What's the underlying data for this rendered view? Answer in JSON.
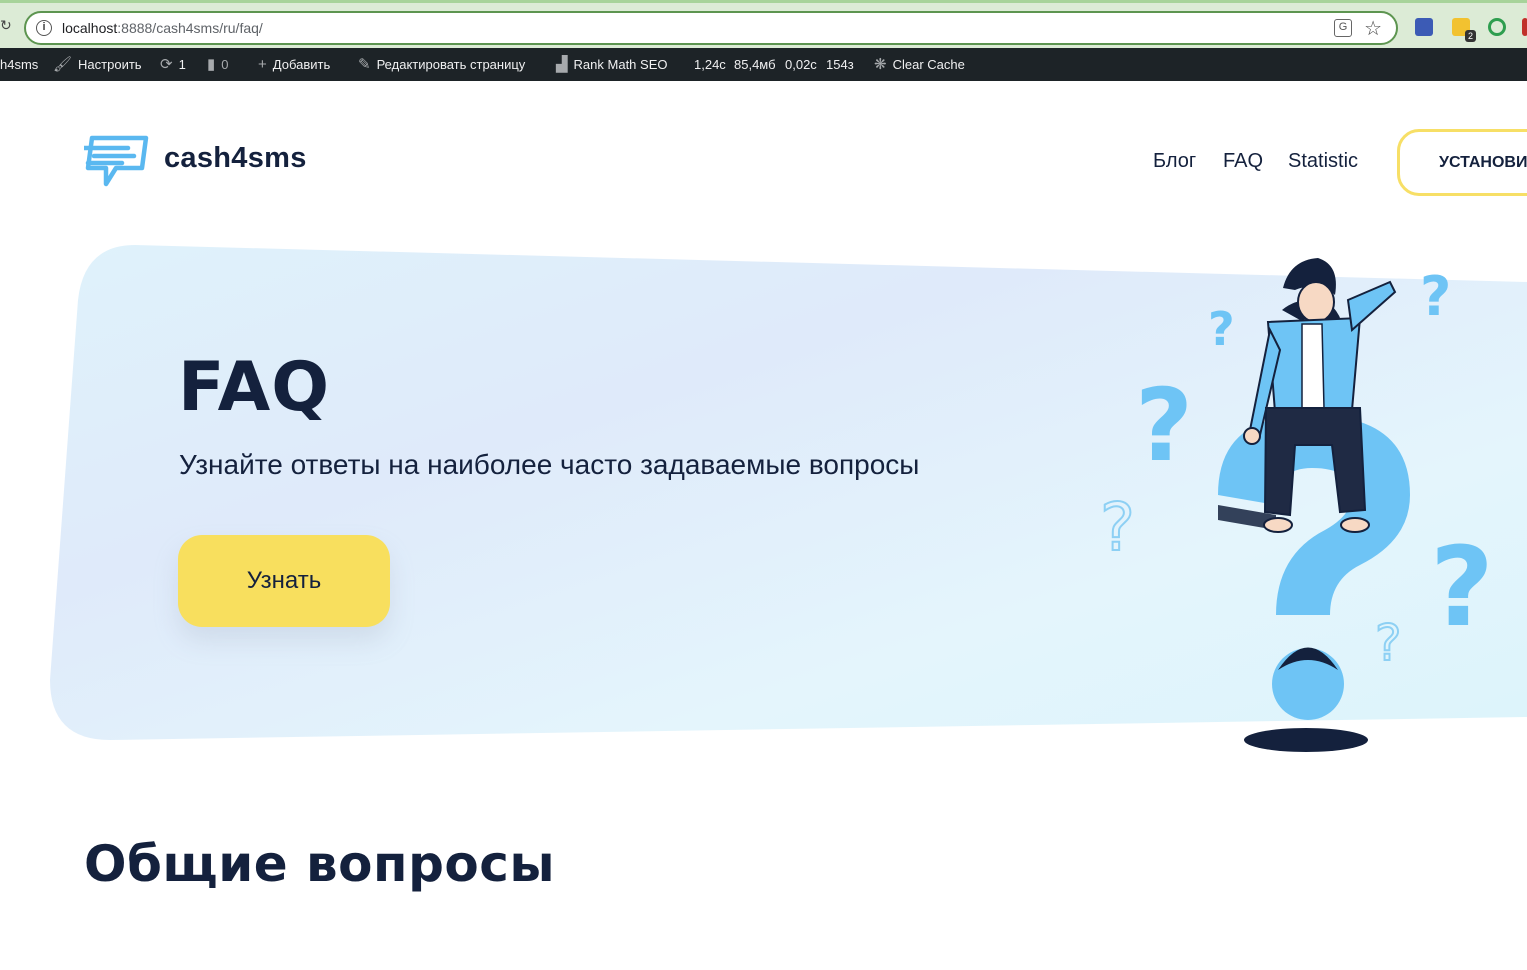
{
  "browser": {
    "url_host": "localhost",
    "url_path": ":8888/cash4sms/ru/faq/",
    "extension_badge": "2"
  },
  "admin_bar": {
    "site_name": "h4sms",
    "customize": "Настроить",
    "updates_count": "1",
    "comments_count": "0",
    "add_new": "Добавить",
    "edit_page": "Редактировать страницу",
    "rank_math": "Rank Math SEO",
    "stat_time": "1,24с",
    "stat_memory": "85,4мб",
    "stat_query_time": "0,02с",
    "stat_queries": "154з",
    "clear_cache": "Clear Cache"
  },
  "header": {
    "logo_text": "cash4sms",
    "nav": [
      "Блог",
      "FAQ",
      "Statistic"
    ],
    "install_button": "УСТАНОВИТЬ"
  },
  "hero": {
    "title": "FAQ",
    "subtitle": "Узнайте ответы на наиболее часто задаваемые вопросы",
    "button": "Узнать"
  },
  "section": {
    "title": "Общие вопросы"
  },
  "colors": {
    "dark_navy": "#14213d",
    "accent_yellow": "#f8df5e",
    "accent_blue": "#6ec4f5",
    "hero_bg": "#e2f3fb"
  }
}
